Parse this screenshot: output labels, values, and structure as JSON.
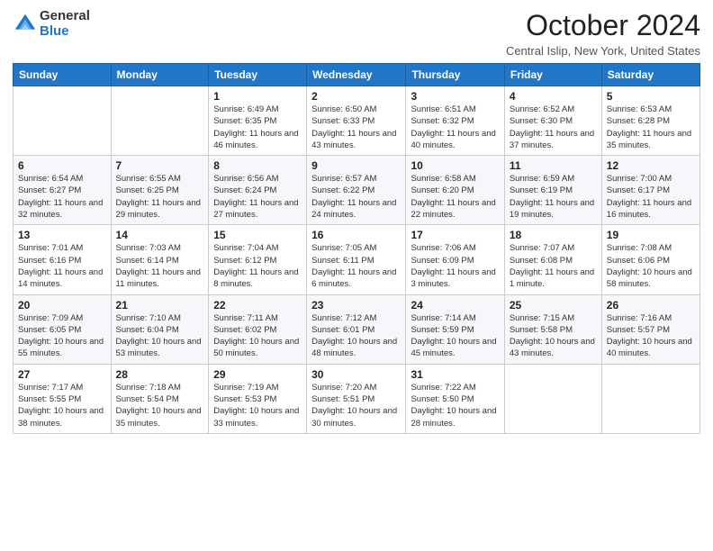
{
  "logo": {
    "general": "General",
    "blue": "Blue"
  },
  "title": "October 2024",
  "location": "Central Islip, New York, United States",
  "days_of_week": [
    "Sunday",
    "Monday",
    "Tuesday",
    "Wednesday",
    "Thursday",
    "Friday",
    "Saturday"
  ],
  "weeks": [
    [
      {
        "day": "",
        "info": ""
      },
      {
        "day": "",
        "info": ""
      },
      {
        "day": "1",
        "info": "Sunrise: 6:49 AM\nSunset: 6:35 PM\nDaylight: 11 hours and 46 minutes."
      },
      {
        "day": "2",
        "info": "Sunrise: 6:50 AM\nSunset: 6:33 PM\nDaylight: 11 hours and 43 minutes."
      },
      {
        "day": "3",
        "info": "Sunrise: 6:51 AM\nSunset: 6:32 PM\nDaylight: 11 hours and 40 minutes."
      },
      {
        "day": "4",
        "info": "Sunrise: 6:52 AM\nSunset: 6:30 PM\nDaylight: 11 hours and 37 minutes."
      },
      {
        "day": "5",
        "info": "Sunrise: 6:53 AM\nSunset: 6:28 PM\nDaylight: 11 hours and 35 minutes."
      }
    ],
    [
      {
        "day": "6",
        "info": "Sunrise: 6:54 AM\nSunset: 6:27 PM\nDaylight: 11 hours and 32 minutes."
      },
      {
        "day": "7",
        "info": "Sunrise: 6:55 AM\nSunset: 6:25 PM\nDaylight: 11 hours and 29 minutes."
      },
      {
        "day": "8",
        "info": "Sunrise: 6:56 AM\nSunset: 6:24 PM\nDaylight: 11 hours and 27 minutes."
      },
      {
        "day": "9",
        "info": "Sunrise: 6:57 AM\nSunset: 6:22 PM\nDaylight: 11 hours and 24 minutes."
      },
      {
        "day": "10",
        "info": "Sunrise: 6:58 AM\nSunset: 6:20 PM\nDaylight: 11 hours and 22 minutes."
      },
      {
        "day": "11",
        "info": "Sunrise: 6:59 AM\nSunset: 6:19 PM\nDaylight: 11 hours and 19 minutes."
      },
      {
        "day": "12",
        "info": "Sunrise: 7:00 AM\nSunset: 6:17 PM\nDaylight: 11 hours and 16 minutes."
      }
    ],
    [
      {
        "day": "13",
        "info": "Sunrise: 7:01 AM\nSunset: 6:16 PM\nDaylight: 11 hours and 14 minutes."
      },
      {
        "day": "14",
        "info": "Sunrise: 7:03 AM\nSunset: 6:14 PM\nDaylight: 11 hours and 11 minutes."
      },
      {
        "day": "15",
        "info": "Sunrise: 7:04 AM\nSunset: 6:12 PM\nDaylight: 11 hours and 8 minutes."
      },
      {
        "day": "16",
        "info": "Sunrise: 7:05 AM\nSunset: 6:11 PM\nDaylight: 11 hours and 6 minutes."
      },
      {
        "day": "17",
        "info": "Sunrise: 7:06 AM\nSunset: 6:09 PM\nDaylight: 11 hours and 3 minutes."
      },
      {
        "day": "18",
        "info": "Sunrise: 7:07 AM\nSunset: 6:08 PM\nDaylight: 11 hours and 1 minute."
      },
      {
        "day": "19",
        "info": "Sunrise: 7:08 AM\nSunset: 6:06 PM\nDaylight: 10 hours and 58 minutes."
      }
    ],
    [
      {
        "day": "20",
        "info": "Sunrise: 7:09 AM\nSunset: 6:05 PM\nDaylight: 10 hours and 55 minutes."
      },
      {
        "day": "21",
        "info": "Sunrise: 7:10 AM\nSunset: 6:04 PM\nDaylight: 10 hours and 53 minutes."
      },
      {
        "day": "22",
        "info": "Sunrise: 7:11 AM\nSunset: 6:02 PM\nDaylight: 10 hours and 50 minutes."
      },
      {
        "day": "23",
        "info": "Sunrise: 7:12 AM\nSunset: 6:01 PM\nDaylight: 10 hours and 48 minutes."
      },
      {
        "day": "24",
        "info": "Sunrise: 7:14 AM\nSunset: 5:59 PM\nDaylight: 10 hours and 45 minutes."
      },
      {
        "day": "25",
        "info": "Sunrise: 7:15 AM\nSunset: 5:58 PM\nDaylight: 10 hours and 43 minutes."
      },
      {
        "day": "26",
        "info": "Sunrise: 7:16 AM\nSunset: 5:57 PM\nDaylight: 10 hours and 40 minutes."
      }
    ],
    [
      {
        "day": "27",
        "info": "Sunrise: 7:17 AM\nSunset: 5:55 PM\nDaylight: 10 hours and 38 minutes."
      },
      {
        "day": "28",
        "info": "Sunrise: 7:18 AM\nSunset: 5:54 PM\nDaylight: 10 hours and 35 minutes."
      },
      {
        "day": "29",
        "info": "Sunrise: 7:19 AM\nSunset: 5:53 PM\nDaylight: 10 hours and 33 minutes."
      },
      {
        "day": "30",
        "info": "Sunrise: 7:20 AM\nSunset: 5:51 PM\nDaylight: 10 hours and 30 minutes."
      },
      {
        "day": "31",
        "info": "Sunrise: 7:22 AM\nSunset: 5:50 PM\nDaylight: 10 hours and 28 minutes."
      },
      {
        "day": "",
        "info": ""
      },
      {
        "day": "",
        "info": ""
      }
    ]
  ]
}
